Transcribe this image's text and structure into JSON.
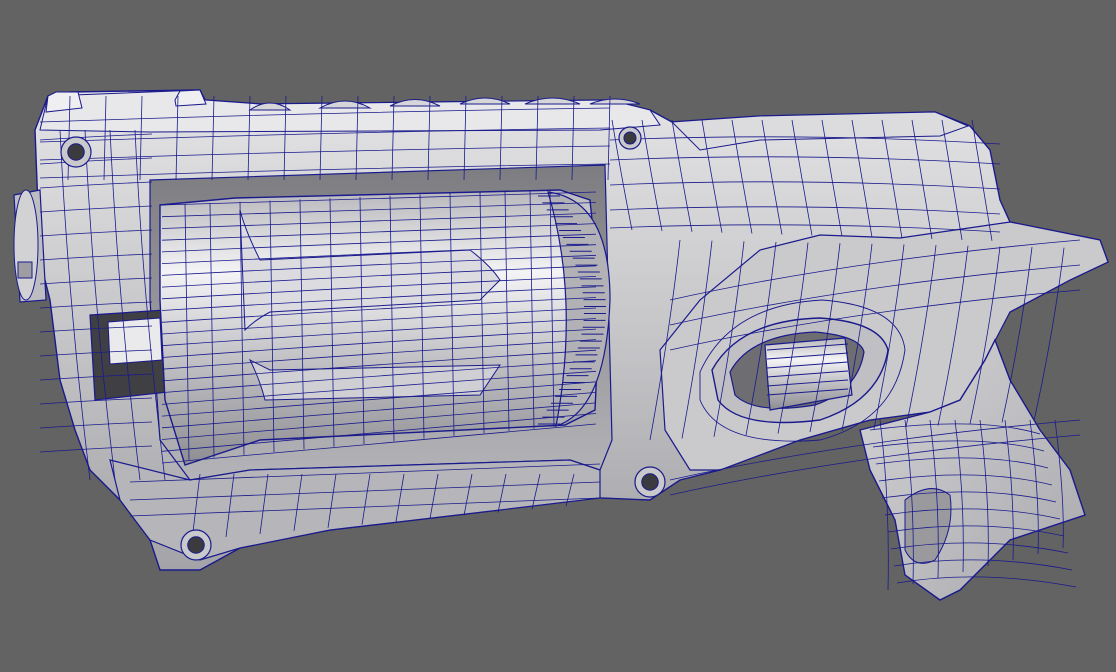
{
  "viewport": {
    "background_color": "#636363"
  },
  "model": {
    "subject": "toy-revolver-blaster",
    "surface_color": "#c9c9cb",
    "surface_shade_color": "#9e9ea2",
    "surface_highlight_color": "#f2f2f4",
    "wire_color": "#1a1a8c",
    "display_mode": "wireframe-on-shaded"
  }
}
